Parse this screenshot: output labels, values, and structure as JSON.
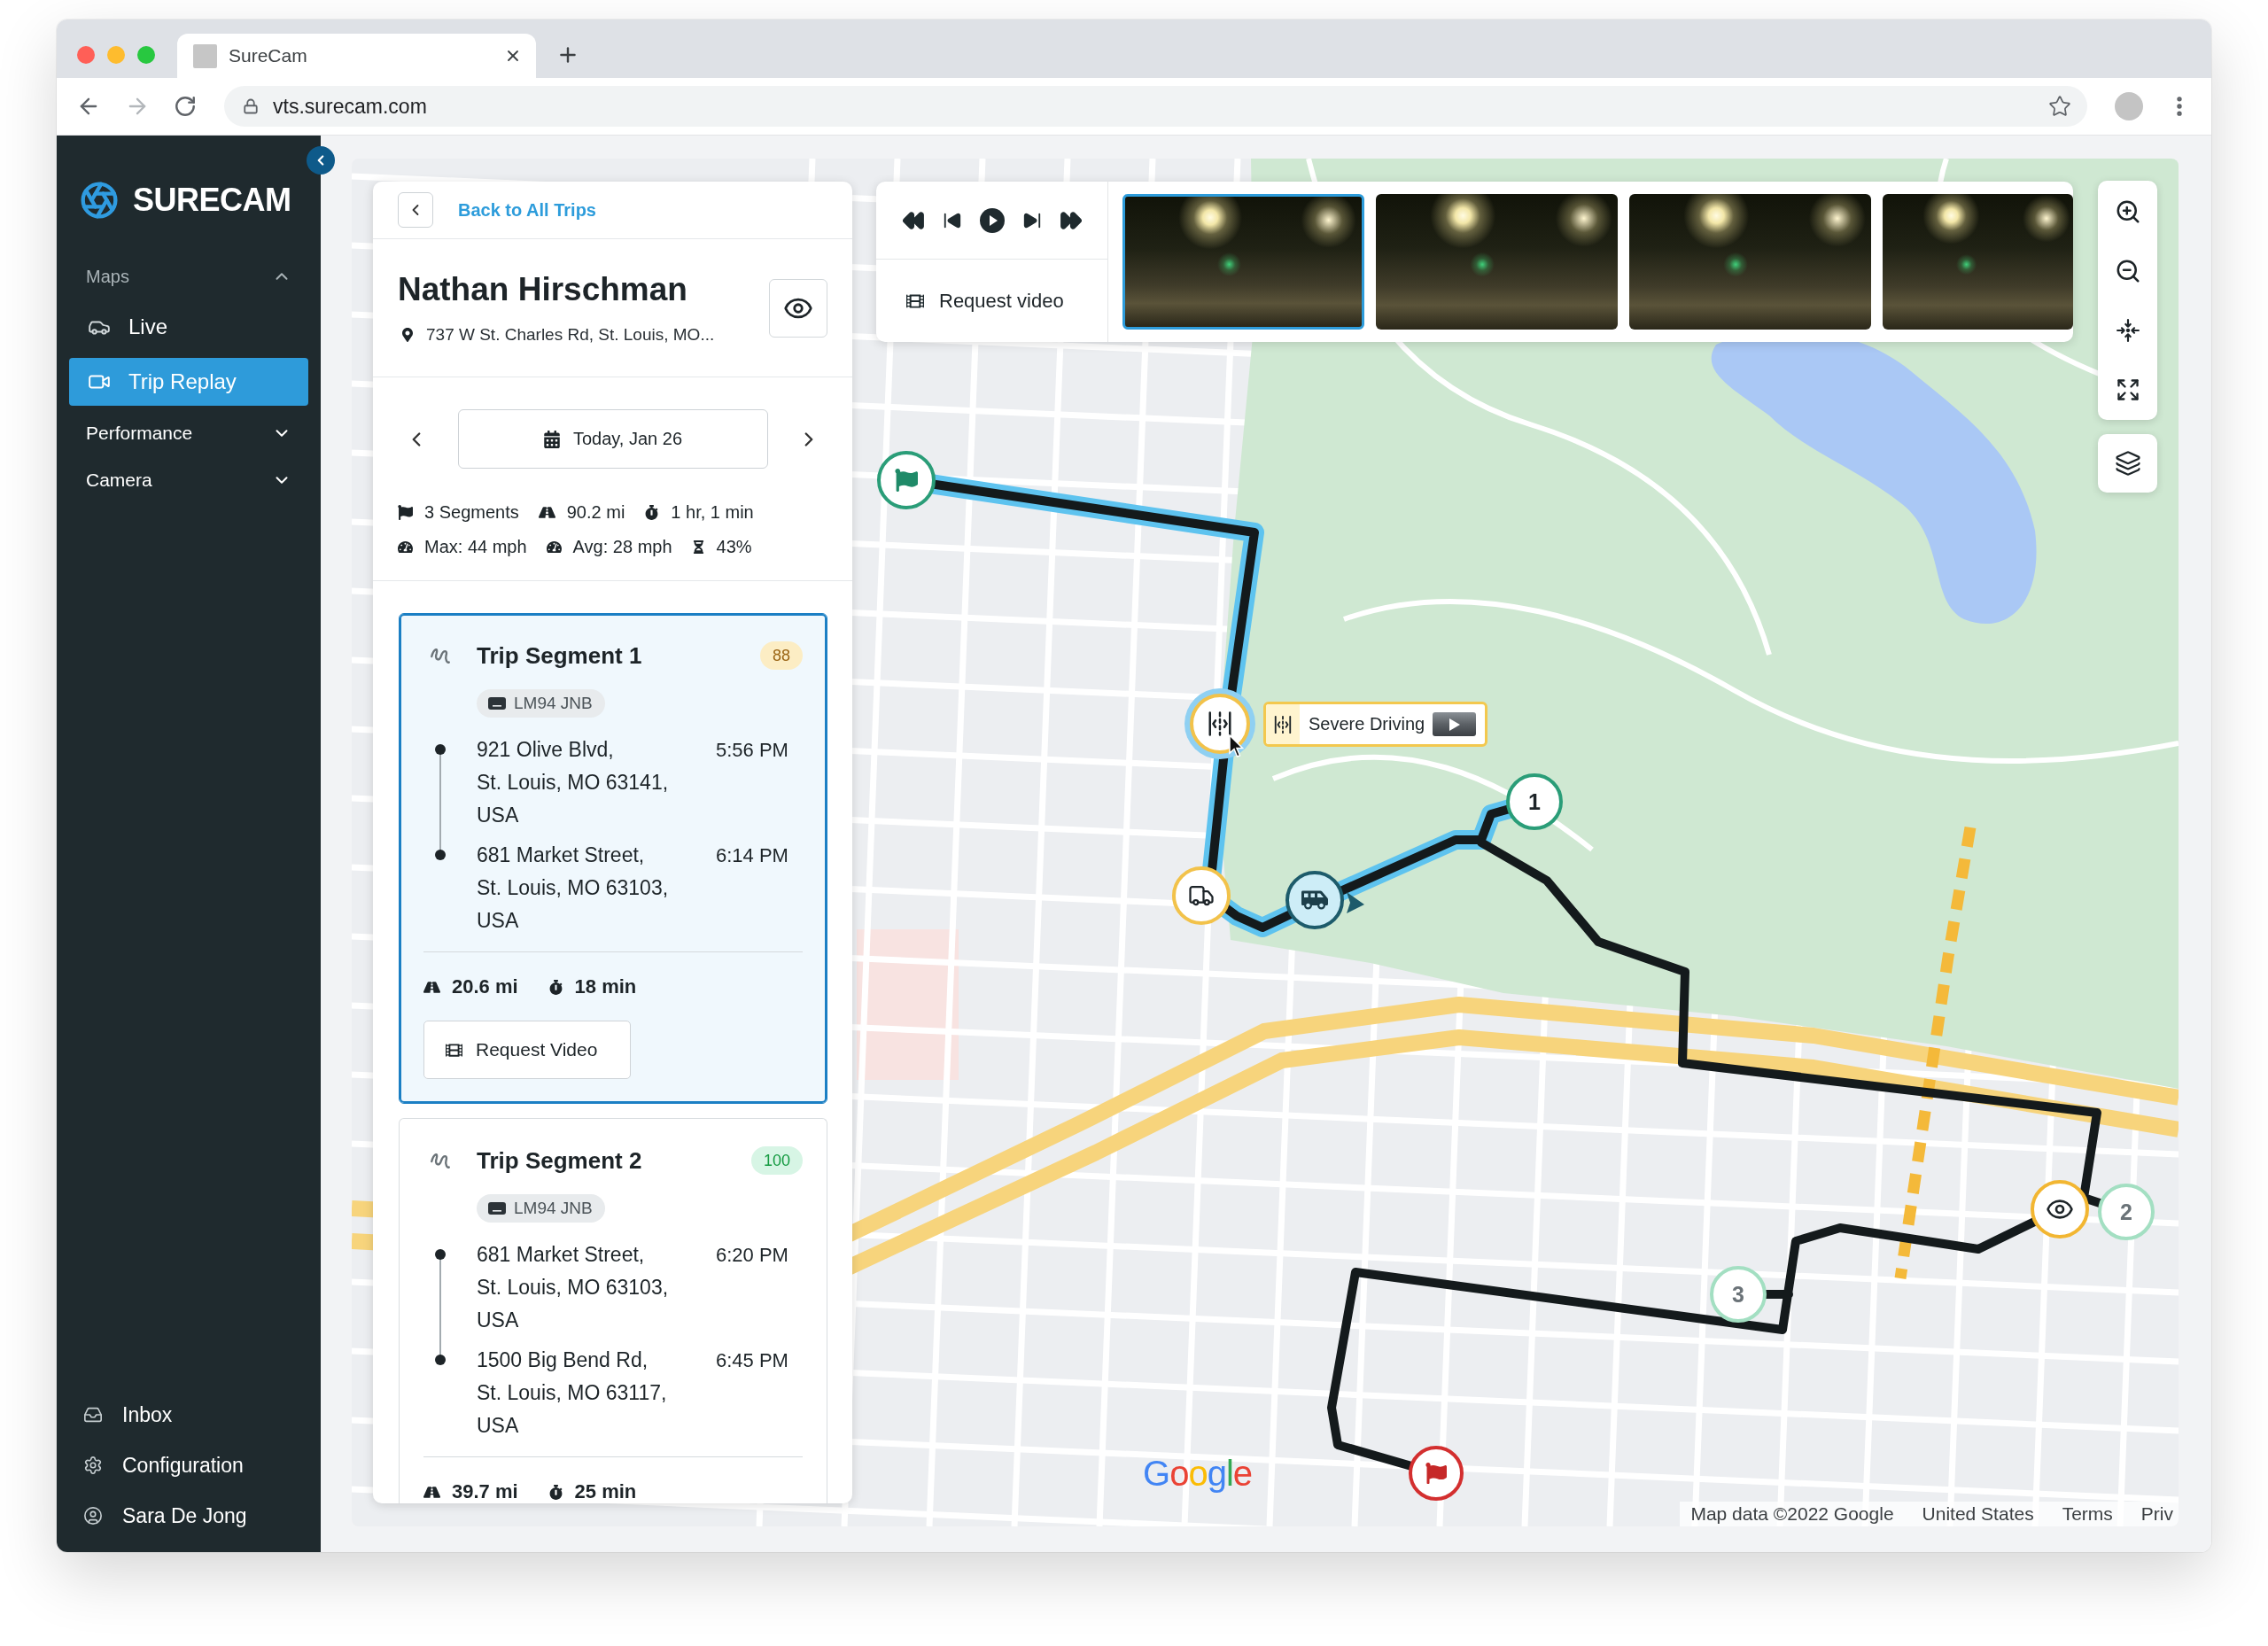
{
  "browser": {
    "tab_title": "SureCam",
    "url": "vts.surecam.com",
    "forward_enabled": false
  },
  "sidebar": {
    "logo": "SURECAM",
    "nav": [
      {
        "label": "Maps",
        "expanded": true,
        "items": [
          {
            "label": "Live",
            "selected": false
          },
          {
            "label": "Trip Replay",
            "selected": true
          }
        ]
      },
      {
        "label": "Performance",
        "expanded": false
      },
      {
        "label": "Camera",
        "expanded": false
      }
    ],
    "footer": [
      "Inbox",
      "Configuration",
      "Sara De Jong"
    ]
  },
  "trip_panel": {
    "back_link": "Back to All Trips",
    "driver": "Nathan Hirschman",
    "address": "737 W St. Charles Rd, St. Louis, MO...",
    "date": "Today, Jan 26",
    "stats": [
      [
        "3 Segments",
        "90.2 mi",
        "1 hr, 1 min"
      ],
      [
        "Max: 44 mph",
        "Avg: 28 mph",
        "43%"
      ]
    ],
    "segments": [
      {
        "title": "Trip Segment 1",
        "score": "88",
        "color": "#fcedc4",
        "selected": true,
        "plate": "LM94 JNB",
        "stops": [
          {
            "address": [
              "921 Olive Blvd,",
              "St. Louis, MO 63141,",
              "USA"
            ],
            "time": "5:56 PM"
          },
          {
            "address": [
              "681 Market Street,",
              "St. Louis, MO 63103,",
              "USA"
            ],
            "time": "6:14 PM"
          }
        ],
        "distance": "20.6 mi",
        "duration": "18 min",
        "button": "Request Video"
      },
      {
        "title": "Trip Segment 2",
        "score": "100",
        "color": "#d7f5e5",
        "selected": false,
        "plate": "LM94 JNB",
        "stops": [
          {
            "address": [
              "681 Market Street,",
              "St. Louis, MO 63103,",
              "USA"
            ],
            "time": "6:20 PM"
          },
          {
            "address": [
              "1500 Big Bend Rd,",
              "St. Louis, MO 63117,",
              "USA"
            ],
            "time": "6:45 PM"
          }
        ],
        "distance": "39.7 mi",
        "duration": "25 min"
      }
    ]
  },
  "playback": {
    "request_video": "Request video",
    "thumbnails": [
      {
        "selected": true
      },
      {
        "selected": false
      },
      {
        "selected": false
      },
      {
        "selected": false
      }
    ]
  },
  "map": {
    "event_tooltip": "Severe Driving",
    "segment_markers": [
      {
        "label": "1",
        "selected": true
      },
      {
        "label": "2",
        "selected": false
      },
      {
        "label": "3",
        "selected": false
      }
    ],
    "logo": "Google",
    "attribution": "Map data ©2022 Google",
    "links": [
      "United States",
      "Terms",
      "Priv"
    ]
  }
}
